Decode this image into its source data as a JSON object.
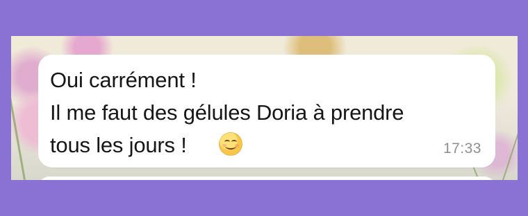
{
  "colors": {
    "frame_purple": "#8a71d4",
    "bubble_white": "#ffffff",
    "message_text": "#161616",
    "timestamp_gray": "#8f8f8f"
  },
  "chat": {
    "message": {
      "text": "Oui carrément !\nIl me faut des gélules Doria à prendre\ntous les jours !",
      "emoji": "smiling-face-icon",
      "time": "17:33"
    }
  }
}
